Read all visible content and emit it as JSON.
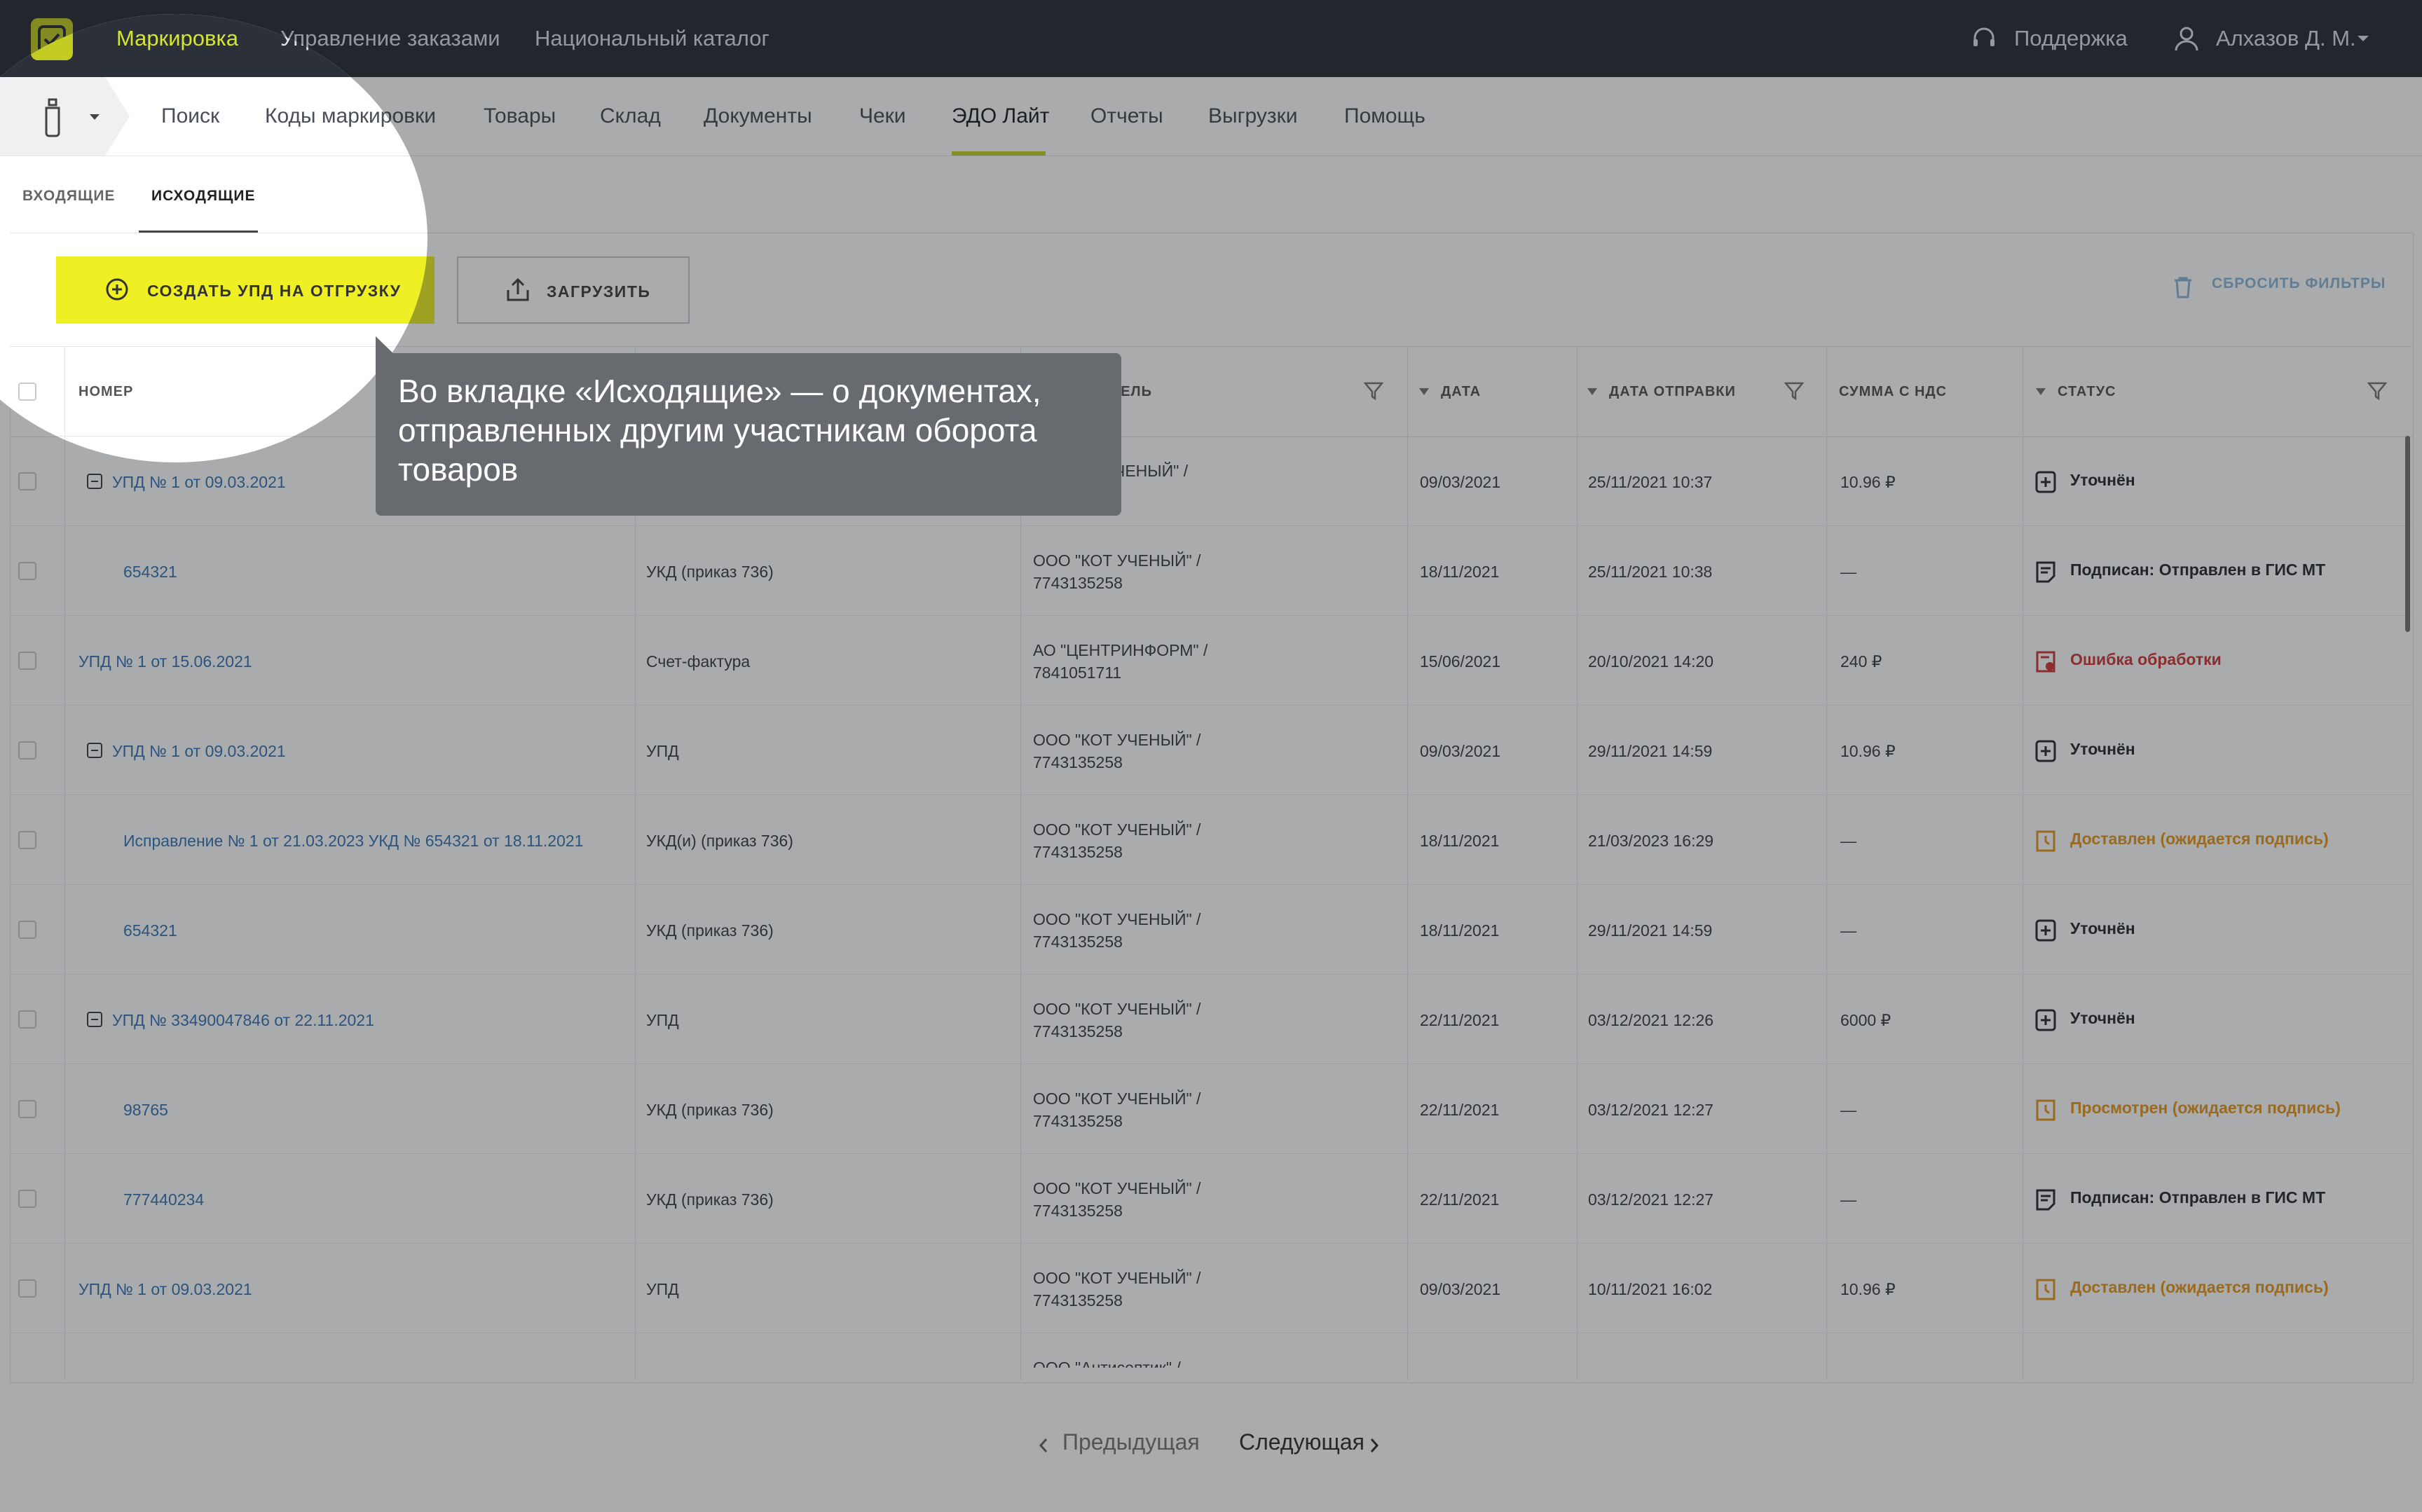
{
  "topbar": {
    "nav": [
      "Маркировка",
      "Управление заказами",
      "Национальный каталог"
    ],
    "support": "Поддержка",
    "user": "Алхазов Д. М."
  },
  "subnav": {
    "items": [
      "Поиск",
      "Коды маркировки",
      "Товары",
      "Склад",
      "Документы",
      "Чеки",
      "ЭДО Лайт",
      "Отчеты",
      "Выгрузки",
      "Помощь"
    ],
    "active": "ЭДО Лайт"
  },
  "tabs": {
    "incoming": "ВХОДЯЩИЕ",
    "outgoing": "ИСХОДЯЩИЕ"
  },
  "toolbar": {
    "create": "СОЗДАТЬ УПД НА ОТГРУЗКУ",
    "upload": "ЗАГРУЗИТЬ",
    "reset": "СБРОСИТЬ ФИЛЬТРЫ"
  },
  "table": {
    "headers": {
      "number": "НОМЕР",
      "recipient": "ТЕЛЬ",
      "date": "ДАТА",
      "sent": "ДАТА ОТПРАВКИ",
      "sum": "СУММА С НДС",
      "status": "СТАТУС"
    },
    "rows": [
      {
        "number": "УПД № 1 от 09.03.2021",
        "type": "",
        "org1": "ЧЕНЫЙ\" /",
        "org2": "",
        "date": "09/03/2021",
        "sent": "25/11/2021 10:37",
        "sum": "10.96 ₽",
        "status": "Уточнён"
      },
      {
        "number": "654321",
        "type": "УКД (приказ 736)",
        "org1": "ООО \"КОТ УЧЕНЫЙ\" /",
        "org2": "7743135258",
        "date": "18/11/2021",
        "sent": "25/11/2021 10:38",
        "sum": "—",
        "status": "Подписан: Отправлен в ГИС МТ"
      },
      {
        "number": "УПД № 1 от 15.06.2021",
        "type": "Счет-фактура",
        "org1": "АО \"ЦЕНТРИНФОРМ\" /",
        "org2": "7841051711",
        "date": "15/06/2021",
        "sent": "20/10/2021 14:20",
        "sum": "240 ₽",
        "status": "Ошибка обработки"
      },
      {
        "number": "УПД № 1 от 09.03.2021",
        "type": "УПД",
        "org1": "ООО \"КОТ УЧЕНЫЙ\" /",
        "org2": "7743135258",
        "date": "09/03/2021",
        "sent": "29/11/2021 14:59",
        "sum": "10.96 ₽",
        "status": "Уточнён"
      },
      {
        "number": "Исправление № 1 от 21.03.2023 УКД № 654321 от 18.11.2021",
        "type": "УКД(и) (приказ 736)",
        "org1": "ООО \"КОТ УЧЕНЫЙ\" /",
        "org2": "7743135258",
        "date": "18/11/2021",
        "sent": "21/03/2023 16:29",
        "sum": "—",
        "status": "Доставлен (ожидается подпись)"
      },
      {
        "number": "654321",
        "type": "УКД (приказ 736)",
        "org1": "ООО \"КОТ УЧЕНЫЙ\" /",
        "org2": "7743135258",
        "date": "18/11/2021",
        "sent": "29/11/2021 14:59",
        "sum": "—",
        "status": "Уточнён"
      },
      {
        "number": "УПД № 33490047846 от 22.11.2021",
        "type": "УПД",
        "org1": "ООО \"КОТ УЧЕНЫЙ\" /",
        "org2": "7743135258",
        "date": "22/11/2021",
        "sent": "03/12/2021 12:26",
        "sum": "6000 ₽",
        "status": "Уточнён"
      },
      {
        "number": "98765",
        "type": "УКД (приказ 736)",
        "org1": "ООО \"КОТ УЧЕНЫЙ\" /",
        "org2": "7743135258",
        "date": "22/11/2021",
        "sent": "03/12/2021 12:27",
        "sum": "—",
        "status": "Просмотрен (ожидается подпись)"
      },
      {
        "number": "777440234",
        "type": "УКД (приказ 736)",
        "org1": "ООО \"КОТ УЧЕНЫЙ\" /",
        "org2": "7743135258",
        "date": "22/11/2021",
        "sent": "03/12/2021 12:27",
        "sum": "—",
        "status": "Подписан: Отправлен в ГИС МТ"
      },
      {
        "number": "УПД № 1 от 09.03.2021",
        "type": "УПД",
        "org1": "ООО \"КОТ УЧЕНЫЙ\" /",
        "org2": "7743135258",
        "date": "09/03/2021",
        "sent": "10/11/2021 16:02",
        "sum": "10.96 ₽",
        "status": "Доставлен (ожидается подпись)"
      }
    ],
    "partial_org": "ООО \"Антисептик\" /"
  },
  "pagination": {
    "prev": "Предыдущая",
    "next": "Следующая"
  },
  "tooltip": {
    "text": "Во вкладке «Исходящие» — о документах, отправленных другим участникам оборота товаров"
  }
}
